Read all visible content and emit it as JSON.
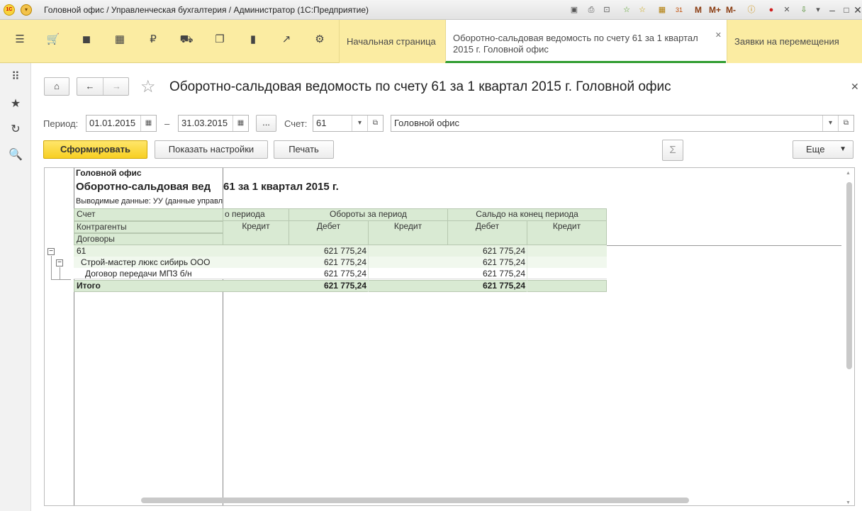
{
  "window": {
    "title": "Головной офис / Управленческая бухгалтерия / Администратор  (1С:Предприятие)"
  },
  "toolbar": {
    "m": "M",
    "m_plus": "M+",
    "m_minus": "M-"
  },
  "tabs": [
    {
      "label": "Начальная страница"
    },
    {
      "label": "Оборотно-сальдовая ведомость по счету 61 за 1 квартал 2015 г. Головной офис"
    },
    {
      "label": "Заявки на перемещения"
    }
  ],
  "page": {
    "title": "Оборотно-сальдовая ведомость по счету 61 за 1 квартал 2015 г. Головной офис"
  },
  "form": {
    "period_label": "Период:",
    "period_from": "01.01.2015",
    "dash": "–",
    "period_to": "31.03.2015",
    "dots": "...",
    "account_label": "Счет:",
    "account": "61",
    "organization": "Головной офис",
    "generate": "Сформировать",
    "settings": "Показать настройки",
    "print": "Печать",
    "more": "Еще",
    "sigma": "Σ"
  },
  "report": {
    "org": "Головной офис",
    "title": "Оборотно-сальдовая вед",
    "title_rest": "61 за 1 квартал 2015 г.",
    "output": "Выводимые данные: УУ (данные управл",
    "col_account": "Счет",
    "col_counterparty": "Контрагенты",
    "col_contract": "Договоры",
    "grp_start": "о периода",
    "grp_turnover": "Обороты за период",
    "grp_end": "Сальдо на конец периода",
    "debit": "Дебет",
    "credit": "Кредит",
    "rows": [
      {
        "name": "61",
        "turn_debit": "621 775,24",
        "end_debit": "621 775,24"
      },
      {
        "name": "Строй-мастер люкс сибирь ООО",
        "turn_debit": "621 775,24",
        "end_debit": "621 775,24"
      },
      {
        "name": "Договор передачи МПЗ б/н",
        "turn_debit": "621 775,24",
        "end_debit": "621 775,24"
      }
    ],
    "total": {
      "name": "Итого",
      "turn_debit": "621 775,24",
      "end_debit": "621 775,24"
    }
  }
}
